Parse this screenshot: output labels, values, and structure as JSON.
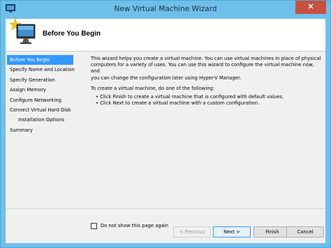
{
  "window": {
    "title": "New Virtual Machine Wizard",
    "close_glyph": "✕"
  },
  "header": {
    "title": "Before You Begin",
    "icon": "new-virtual-machine-icon"
  },
  "nav": {
    "items": [
      {
        "label": "Before You Begin",
        "active": true
      },
      {
        "label": "Specify Name and Location"
      },
      {
        "label": "Specify Generation"
      },
      {
        "label": "Assign Memory"
      },
      {
        "label": "Configure Networking"
      },
      {
        "label": "Connect Virtual Hard Disk"
      },
      {
        "label": "Installation Options",
        "sub": true
      },
      {
        "label": "Summary"
      }
    ]
  },
  "content": {
    "intro_1": "This wizard helps you create a virtual machine. You can use virtual machines in place of physical",
    "intro_2": "computers for a variety of uses. You can use this wizard to configure the virtual machine now, and",
    "intro_3": "you can change the configuration later using Hyper-V Manager.",
    "instruction": "To create a virtual machine, do one of the following:",
    "bullet_1": "• Click Finish to create a virtual machine that is configured with default values.",
    "bullet_2": "• Click Next to create a virtual machine with a custom configuration."
  },
  "checkbox": {
    "label": "Do not show this page again",
    "checked": false
  },
  "buttons": {
    "previous": "< Previous",
    "next": "Next >",
    "finish": "Finish",
    "cancel": "Cancel"
  },
  "colors": {
    "title_bar": "#6ec0ea",
    "selection": "#3399ff",
    "close_button": "#c7503f"
  }
}
